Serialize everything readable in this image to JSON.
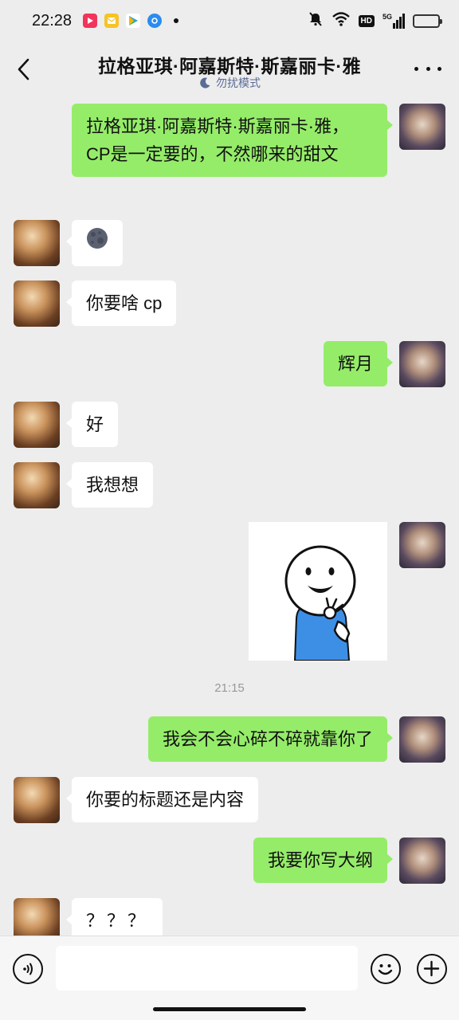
{
  "status_bar": {
    "time": "22:28",
    "notification_icons": [
      "video-app-icon",
      "mail-app-icon",
      "play-store-icon",
      "browser-app-icon"
    ],
    "right_icons": [
      "mute-icon",
      "wifi-icon",
      "hd-icon",
      "signal-5g-icon",
      "battery-icon"
    ],
    "hd_label": "HD",
    "network_label": "5G",
    "battery_level": 0.3
  },
  "header": {
    "title": "拉格亚琪·阿嘉斯特·斯嘉丽卡·雅",
    "subtitle": "勿扰模式"
  },
  "messages": [
    {
      "side": "right",
      "type": "text",
      "text": "拉格亚琪·阿嘉斯特·斯嘉丽卡·雅， CP是一定要的，不然哪来的甜文"
    },
    {
      "side": "left",
      "type": "emoji",
      "text": "🌑"
    },
    {
      "side": "left",
      "type": "text",
      "text": "你要啥 cp"
    },
    {
      "side": "right",
      "type": "text",
      "text": "辉月"
    },
    {
      "side": "left",
      "type": "text",
      "text": "好"
    },
    {
      "side": "left",
      "type": "text",
      "text": "我想想"
    },
    {
      "side": "right",
      "type": "sticker",
      "sticker": "smiling-okay-person-sticker"
    },
    {
      "type": "timestamp",
      "text": "21:15"
    },
    {
      "side": "right",
      "type": "text",
      "text": "我会不会心碎不碎就靠你了"
    },
    {
      "side": "left",
      "type": "text",
      "text": "你要的标题还是内容"
    },
    {
      "side": "right",
      "type": "text",
      "text": "我要你写大纲"
    },
    {
      "side": "left",
      "type": "text",
      "text": "？？？"
    }
  ],
  "input_bar": {
    "placeholder": "",
    "value": ""
  },
  "colors": {
    "background": "#ededed",
    "bubble_mine": "#95ec69",
    "bubble_other": "#ffffff",
    "subtitle": "#5b6b96"
  }
}
